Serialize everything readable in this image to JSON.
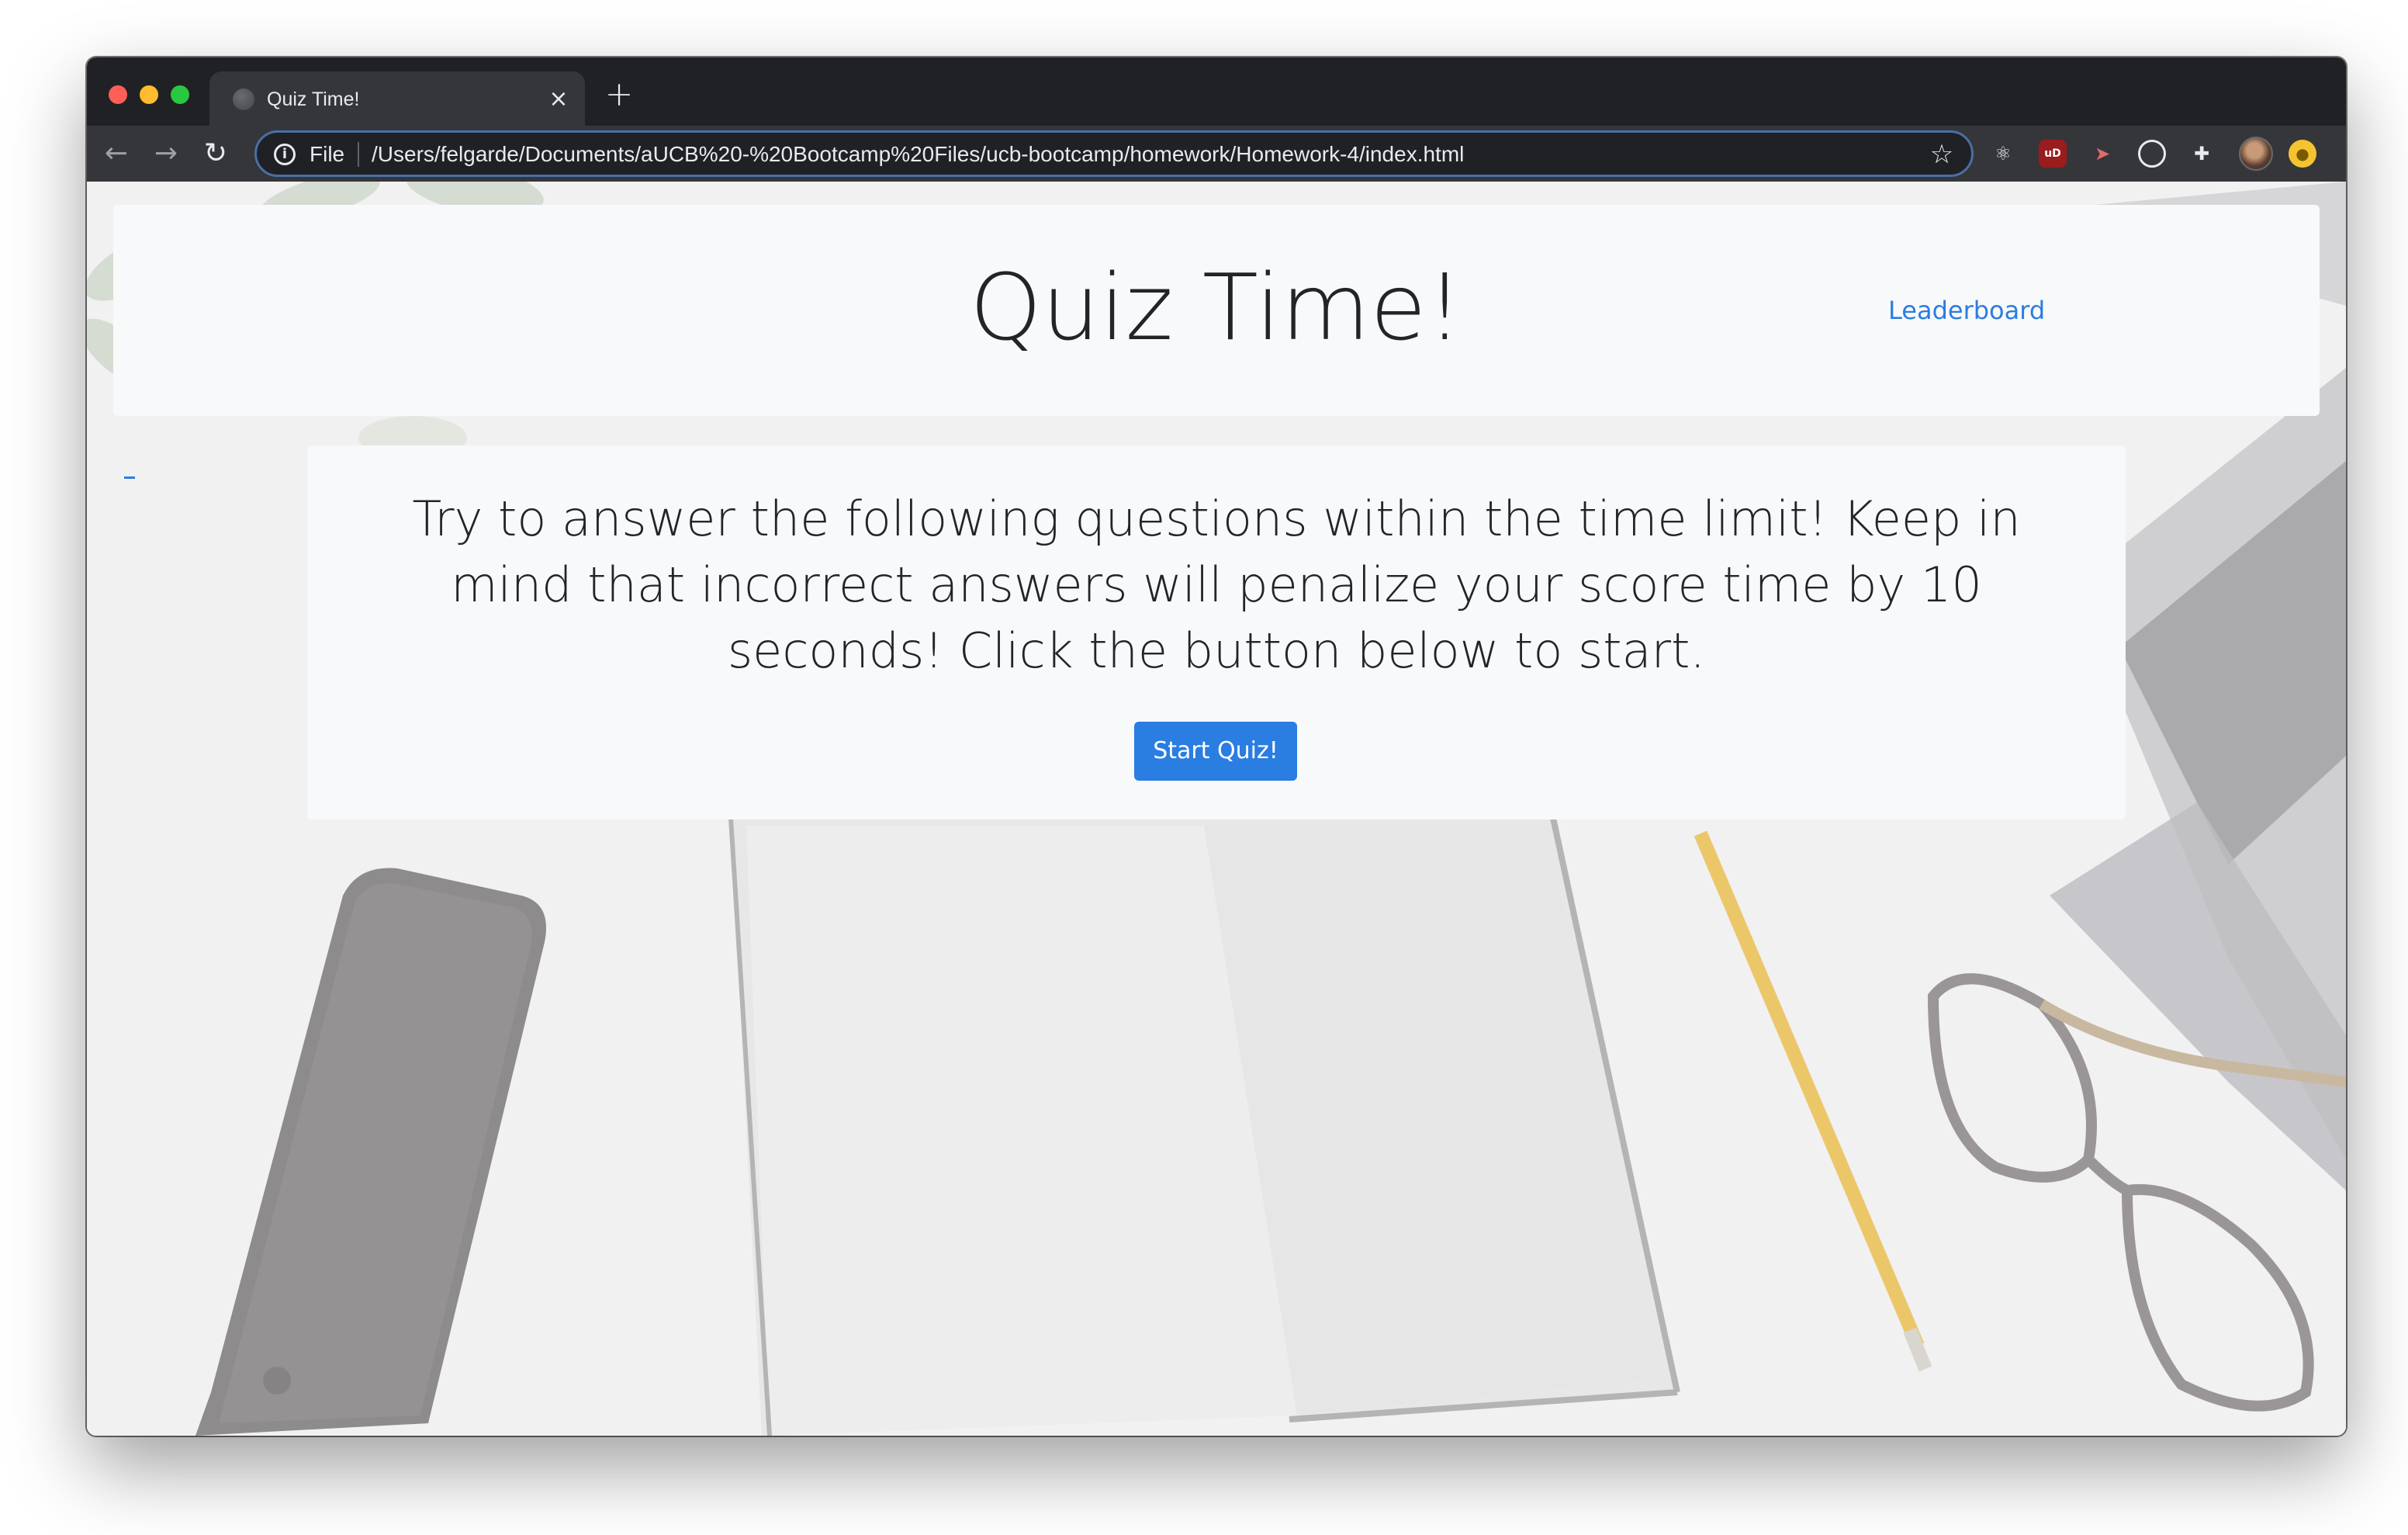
{
  "browser": {
    "tab": {
      "title": "Quiz Time!",
      "close_glyph": "×",
      "favicon": "globe-icon"
    },
    "new_tab_glyph": "+",
    "nav": {
      "back_glyph": "←",
      "forward_glyph": "→",
      "reload_glyph": "↻"
    },
    "omnibox": {
      "scheme_label": "File",
      "url": "/Users/felgarde/Documents/aUCB%20-%20Bootcamp%20Files/ucb-bootcamp/homework/Homework-4/index.html",
      "info_glyph": "i",
      "star_glyph": "☆"
    },
    "extensions": [
      {
        "name": "react-devtools-icon",
        "glyph": "⚛"
      },
      {
        "name": "ublock-icon",
        "glyph": "uD"
      },
      {
        "name": "arrow-extension-icon",
        "glyph": "➤"
      },
      {
        "name": "target-extension-icon",
        "glyph": ""
      },
      {
        "name": "puzzle-extensions-icon",
        "glyph": "✚"
      },
      {
        "name": "coin-extension-icon",
        "glyph": "●"
      }
    ]
  },
  "page": {
    "title": "Quiz Time!",
    "leaderboard_link": "Leaderboard",
    "intro_text": "Try to answer the following questions within the time limit! Keep in mind that incorrect answers will penalize your score time by 10 seconds! Click the button below to start.",
    "start_button": "Start Quiz!"
  },
  "colors": {
    "accent": "#2a7de1",
    "titlebar": "#202124",
    "toolbar": "#35363a",
    "card_bg": "#f8f9fa",
    "text": "#212529"
  }
}
